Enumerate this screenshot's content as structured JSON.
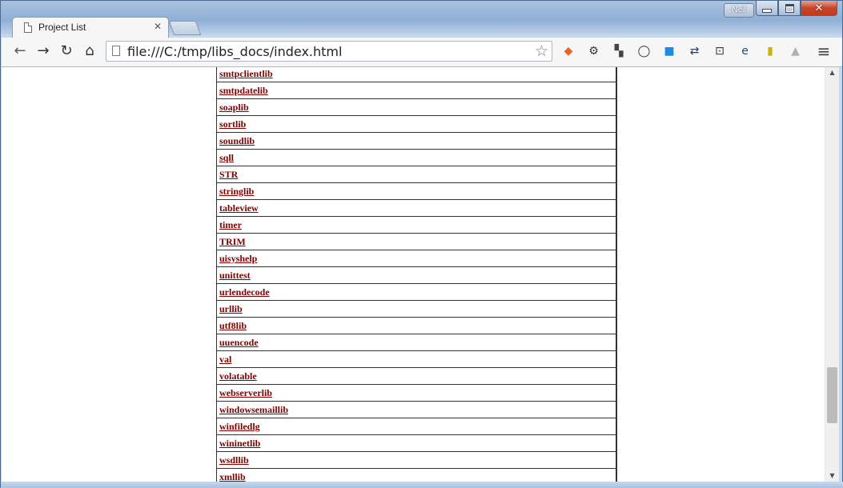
{
  "window": {
    "user": "Neil",
    "tab_title": "Project List"
  },
  "toolbar": {
    "url": "file:///C:/tmp/libs_docs/index.html",
    "back_glyph": "←",
    "forward_glyph": "→",
    "reload_glyph": "↻",
    "home_glyph": "⌂",
    "menu_glyph": "≡",
    "extensions": [
      {
        "name": "ext-colorful-icon",
        "color": "#e0662a"
      },
      {
        "name": "gear-icon",
        "color": "#333333"
      },
      {
        "name": "ext-squares-icon",
        "color": "#444444"
      },
      {
        "name": "ext-ring-icon",
        "color": "#333333"
      },
      {
        "name": "ext-blue-square-icon",
        "color": "#1e88e5"
      },
      {
        "name": "ext-hands-icon",
        "color": "#1b3d7a"
      },
      {
        "name": "ext-car-icon",
        "color": "#333333"
      },
      {
        "name": "ext-e-circle-icon",
        "color": "#1a4f7a"
      },
      {
        "name": "ext-yellow-green-icon",
        "color": "#c8b400"
      },
      {
        "name": "drive-icon",
        "color": "#b0b0b0"
      }
    ]
  },
  "libraries": [
    "smtpclientlib",
    "smtpdatelib",
    "soaplib",
    "sortlib",
    "soundlib",
    "sqll",
    "STR",
    "stringlib",
    "tableview",
    "timer",
    "TRIM",
    "uisyshelp",
    "unittest",
    "urlendecode",
    "urllib",
    "utf8lib",
    "uuencode",
    "val",
    "volatable",
    "webserverlib",
    "windowsemaillib",
    "winfiledlg",
    "wininetlib",
    "wsdllib",
    "xmllib"
  ],
  "scrollbar": {
    "up_glyph": "▲",
    "down_glyph": "▼",
    "position_fraction": 0.86
  }
}
